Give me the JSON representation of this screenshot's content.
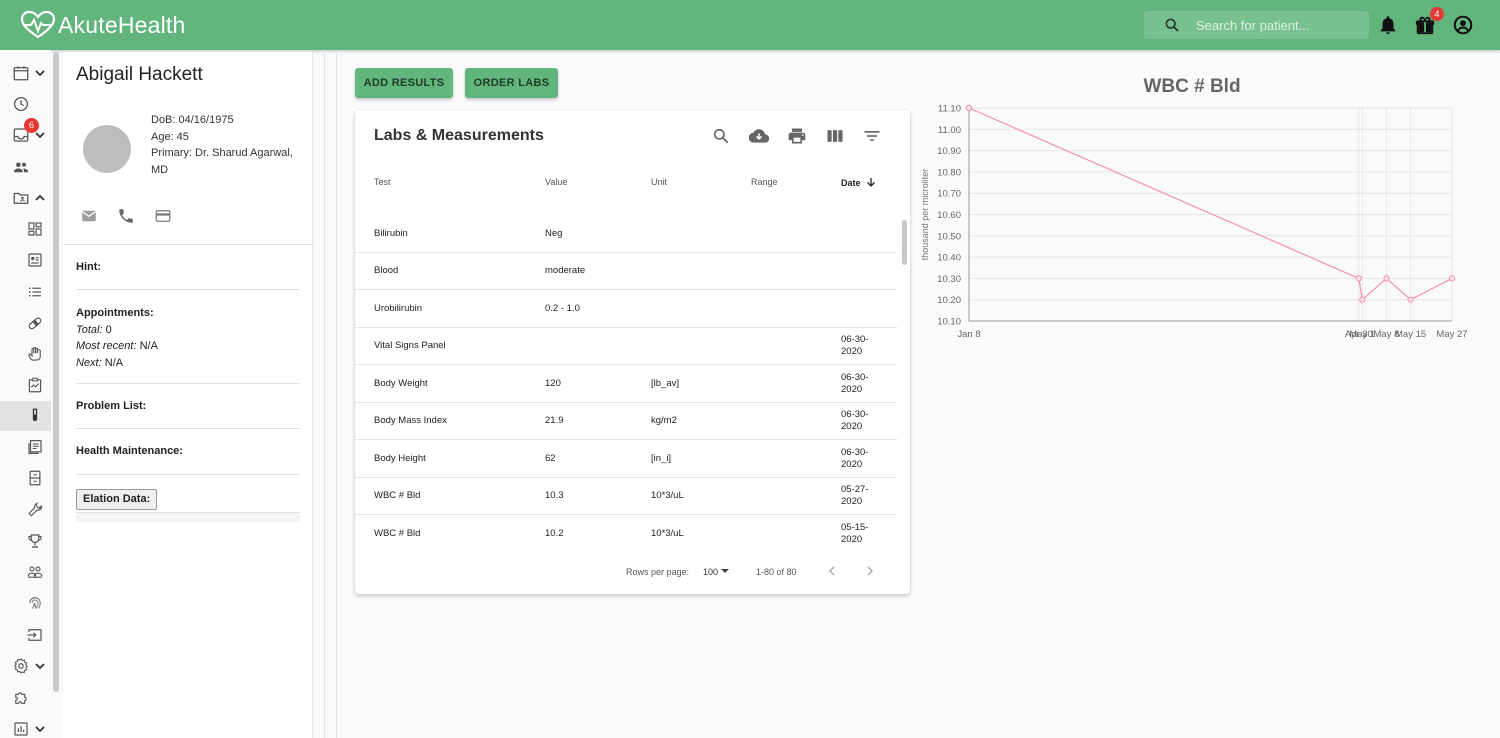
{
  "app": {
    "brand": "AkuteHealth",
    "search_placeholder": "Search for patient...",
    "gift_badge": "4",
    "inbox_badge": "6",
    "colors": {
      "primary": "#62b57d",
      "badge": "#e53935",
      "chart_line": "#f48fb1"
    }
  },
  "sidebar": {
    "icons": [
      "calendar-icon",
      "clock-icon",
      "inbox-icon",
      "people-icon",
      "folder-icon",
      "dashboard-icon",
      "id-card-icon",
      "list-icon",
      "pill-icon",
      "hand-icon",
      "clipboard-chart-icon",
      "test-tube-icon",
      "document-icon",
      "cabinet-icon",
      "wrench-icon",
      "trophy-icon",
      "group-icon",
      "fingerprint-icon",
      "input-icon",
      "settings-icon",
      "puzzle-icon",
      "bar-chart-icon"
    ],
    "active": "test-tube-icon"
  },
  "patient": {
    "name": "Abigail Hackett",
    "dob": "DoB: 04/16/1975",
    "age": "Age: 45",
    "primary": "Primary: Dr. Sharud Agarwal, MD",
    "hint_label": "Hint:",
    "appointments_label": "Appointments:",
    "total_label": "Total:",
    "total_value": " 0",
    "most_recent_label": "Most recent:",
    "most_recent_value": " N/A",
    "next_label": "Next:",
    "next_value": " N/A",
    "problem_list_label": "Problem List:",
    "health_maintenance_label": "Health Maintenance:",
    "elation_label": "Elation Data:"
  },
  "actions": {
    "add_results": "ADD RESULTS",
    "order_labs": "ORDER LABS"
  },
  "labs": {
    "title": "Labs & Measurements",
    "columns": [
      "Test",
      "Value",
      "Unit",
      "Range",
      "Date"
    ],
    "rows": [
      {
        "test": "Bilirubin",
        "value": "Neg",
        "unit": "",
        "range": "",
        "date": ""
      },
      {
        "test": "Blood",
        "value": "moderate",
        "unit": "",
        "range": "",
        "date": ""
      },
      {
        "test": "Urobilirubin",
        "value": "0.2 - 1.0",
        "unit": "",
        "range": "",
        "date": ""
      },
      {
        "test": "Vital Signs Panel",
        "value": "",
        "unit": "",
        "range": "",
        "date": "06-30-\n2020"
      },
      {
        "test": "Body Weight",
        "value": "120",
        "unit": "[lb_av]",
        "range": "",
        "date": "06-30-\n2020"
      },
      {
        "test": "Body Mass Index",
        "value": "21.9",
        "unit": "kg/m2",
        "range": "",
        "date": "06-30-\n2020"
      },
      {
        "test": "Body Height",
        "value": "62",
        "unit": "[in_i]",
        "range": "",
        "date": "06-30-\n2020"
      },
      {
        "test": "WBC # Bld",
        "value": "10.3",
        "unit": "10*3/uL",
        "range": "",
        "date": "05-27-\n2020"
      },
      {
        "test": "WBC # Bld",
        "value": "10.2",
        "unit": "10*3/uL",
        "range": "",
        "date": "05-15-\n2020"
      }
    ],
    "rows_per_page_label": "Rows per page:",
    "rows_per_page": "100",
    "range_text": "1-80 of 80"
  },
  "chart_data": {
    "type": "line",
    "title": "WBC # Bld",
    "ylabel": "thousand per microliter",
    "xlabel": "",
    "ylim": [
      10.1,
      11.1
    ],
    "yticks": [
      "11.10",
      "11.00",
      "10.90",
      "10.80",
      "10.70",
      "10.60",
      "10.50",
      "10.40",
      "10.30",
      "10.20",
      "10.10"
    ],
    "xticks": [
      "Jan 8",
      "Apr 30",
      "May 1",
      "May 8",
      "May 15",
      "May 27"
    ],
    "series": [
      {
        "x": [
          "Jan 8",
          "Apr 30",
          "May 1",
          "May 8",
          "May 15",
          "May 27"
        ],
        "values": [
          11.1,
          10.3,
          10.2,
          10.3,
          10.2,
          10.3
        ]
      }
    ],
    "grid": true
  }
}
